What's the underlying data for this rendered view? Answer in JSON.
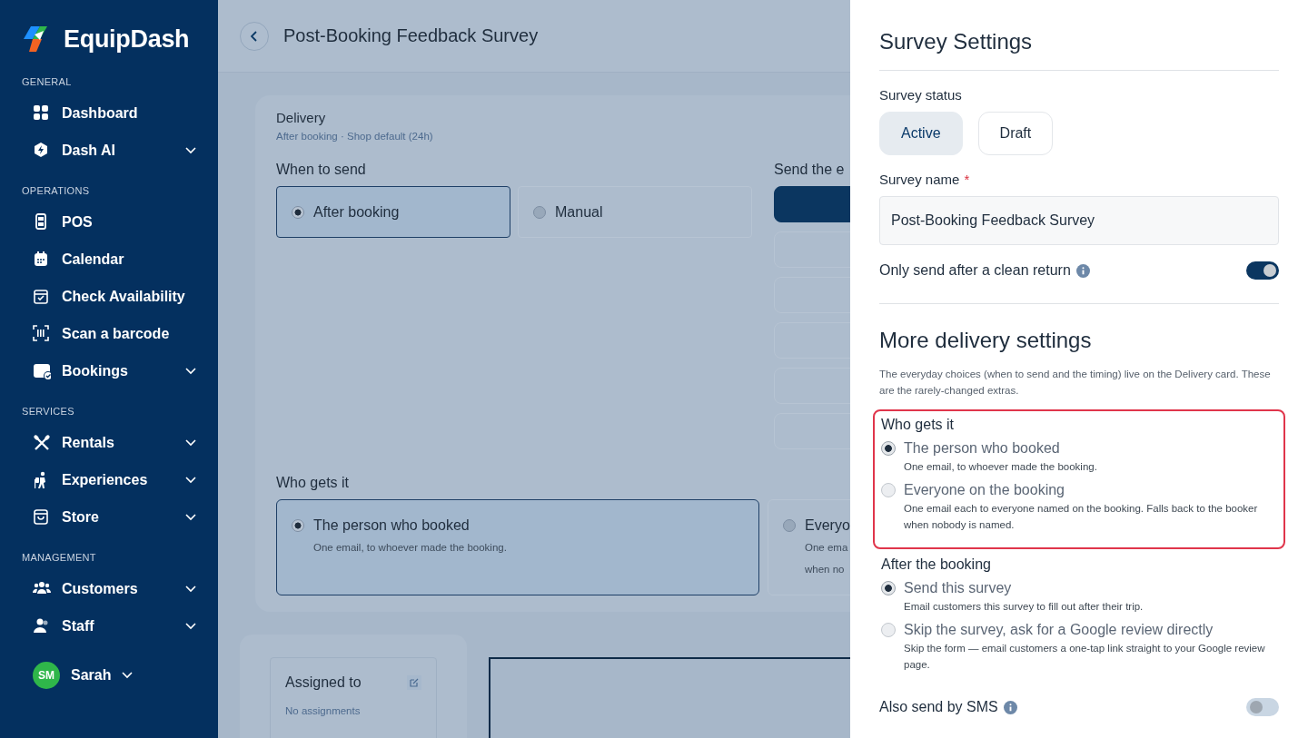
{
  "sidebar": {
    "logo": "EquipDash",
    "sections": [
      {
        "title": "GENERAL",
        "items": [
          {
            "label": "Dashboard",
            "expandable": false
          },
          {
            "label": "Dash AI",
            "expandable": true
          }
        ]
      },
      {
        "title": "OPERATIONS",
        "items": [
          {
            "label": "POS",
            "expandable": false
          },
          {
            "label": "Calendar",
            "expandable": false
          },
          {
            "label": "Check Availability",
            "expandable": false
          },
          {
            "label": "Scan a barcode",
            "expandable": false
          },
          {
            "label": "Bookings",
            "expandable": true
          }
        ]
      },
      {
        "title": "SERVICES",
        "items": [
          {
            "label": "Rentals",
            "expandable": true
          },
          {
            "label": "Experiences",
            "expandable": true
          },
          {
            "label": "Store",
            "expandable": true
          }
        ]
      },
      {
        "title": "MANAGEMENT",
        "items": [
          {
            "label": "Customers",
            "expandable": true
          },
          {
            "label": "Staff",
            "expandable": true
          }
        ]
      }
    ],
    "user": {
      "initials": "SM",
      "name": "Sarah"
    }
  },
  "header": {
    "title": "Post-Booking Feedback Survey"
  },
  "delivery": {
    "title": "Delivery",
    "summary": "After booking · Shop default (24h)",
    "when_to_send": {
      "label": "When to send",
      "options": [
        {
          "label": "After booking",
          "selected": true
        },
        {
          "label": "Manual",
          "selected": false
        }
      ]
    },
    "send_column": {
      "label": "Send the e",
      "options": [
        {
          "selected": true
        },
        {
          "selected": false
        },
        {
          "selected": false
        },
        {
          "selected": false
        },
        {
          "selected": false
        },
        {
          "selected": false
        }
      ]
    },
    "who_gets_it": {
      "label": "Who gets it",
      "options": [
        {
          "label": "The person who booked",
          "description_lines": [
            "One email, to whoever made the booking."
          ],
          "selected": true
        },
        {
          "label": "Everyo",
          "description_lines": [
            "One ema",
            "when no"
          ],
          "selected": false
        }
      ]
    }
  },
  "assignments": {
    "title": "Assigned to",
    "value": "No assignments"
  },
  "settings": {
    "title": "Survey Settings",
    "status": {
      "label": "Survey status",
      "options": [
        {
          "label": "Active",
          "selected": true
        },
        {
          "label": "Draft",
          "selected": false
        }
      ]
    },
    "name": {
      "label": "Survey name",
      "required_mark": "*",
      "value": "Post-Booking Feedback Survey"
    },
    "clean_return": {
      "label": "Only send after a clean return",
      "on": true
    },
    "more": {
      "title": "More delivery settings",
      "note": "The everyday choices (when to send and the timing) live on the Delivery card. These are the rarely-changed extras.",
      "groups": [
        {
          "label": "Who gets it",
          "highlighted": true,
          "options": [
            {
              "label": "The person who booked",
              "description": "One email, to whoever made the booking.",
              "selected": true
            },
            {
              "label": "Everyone on the booking",
              "description": "One email each to everyone named on the booking. Falls back to the booker when nobody is named.",
              "selected": false
            }
          ]
        },
        {
          "label": "After the booking",
          "highlighted": false,
          "options": [
            {
              "label": "Send this survey",
              "description": "Email customers this survey to fill out after their trip.",
              "selected": true
            },
            {
              "label": "Skip the survey, ask for a Google review directly",
              "description": "Skip the form — email customers a one-tap link straight to your Google review page.",
              "selected": false
            }
          ]
        }
      ]
    },
    "sms": {
      "label": "Also send by SMS",
      "on": false
    }
  }
}
